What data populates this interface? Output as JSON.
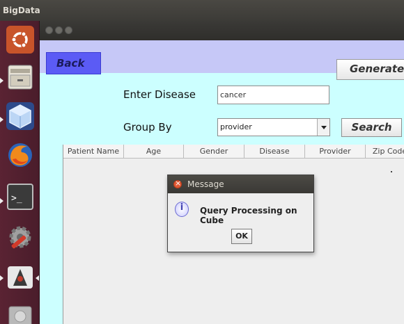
{
  "top_panel": {
    "title": "BigData"
  },
  "launcher": {
    "items": [
      {
        "icon": "ubuntu-dash-icon"
      },
      {
        "icon": "file-manager-icon"
      },
      {
        "icon": "virtualbox-cube-icon"
      },
      {
        "icon": "firefox-icon"
      },
      {
        "icon": "terminal-icon",
        "glyph": ">_"
      },
      {
        "icon": "system-settings-icon"
      },
      {
        "icon": "java-app-icon"
      },
      {
        "icon": "disk-drive-icon"
      }
    ]
  },
  "app": {
    "back_label": "Back",
    "generate_label": "Generate",
    "disease_label": "Enter Disease",
    "disease_value": "cancer",
    "groupby_label": "Group By",
    "groupby_value": "provider",
    "search_label": "Search",
    "table": {
      "columns": [
        "Patient Name",
        "Age",
        "Gender",
        "Disease",
        "Provider",
        "Zip Code"
      ]
    }
  },
  "dialog": {
    "title": "Message",
    "info_glyph": "i",
    "message": "Query Processing on Cube",
    "ok_label": "OK"
  },
  "colors": {
    "banner": "#c6c8f7",
    "content": "#ccffff",
    "back_button": "#5b5bf5",
    "launcher": "#5a2333"
  }
}
